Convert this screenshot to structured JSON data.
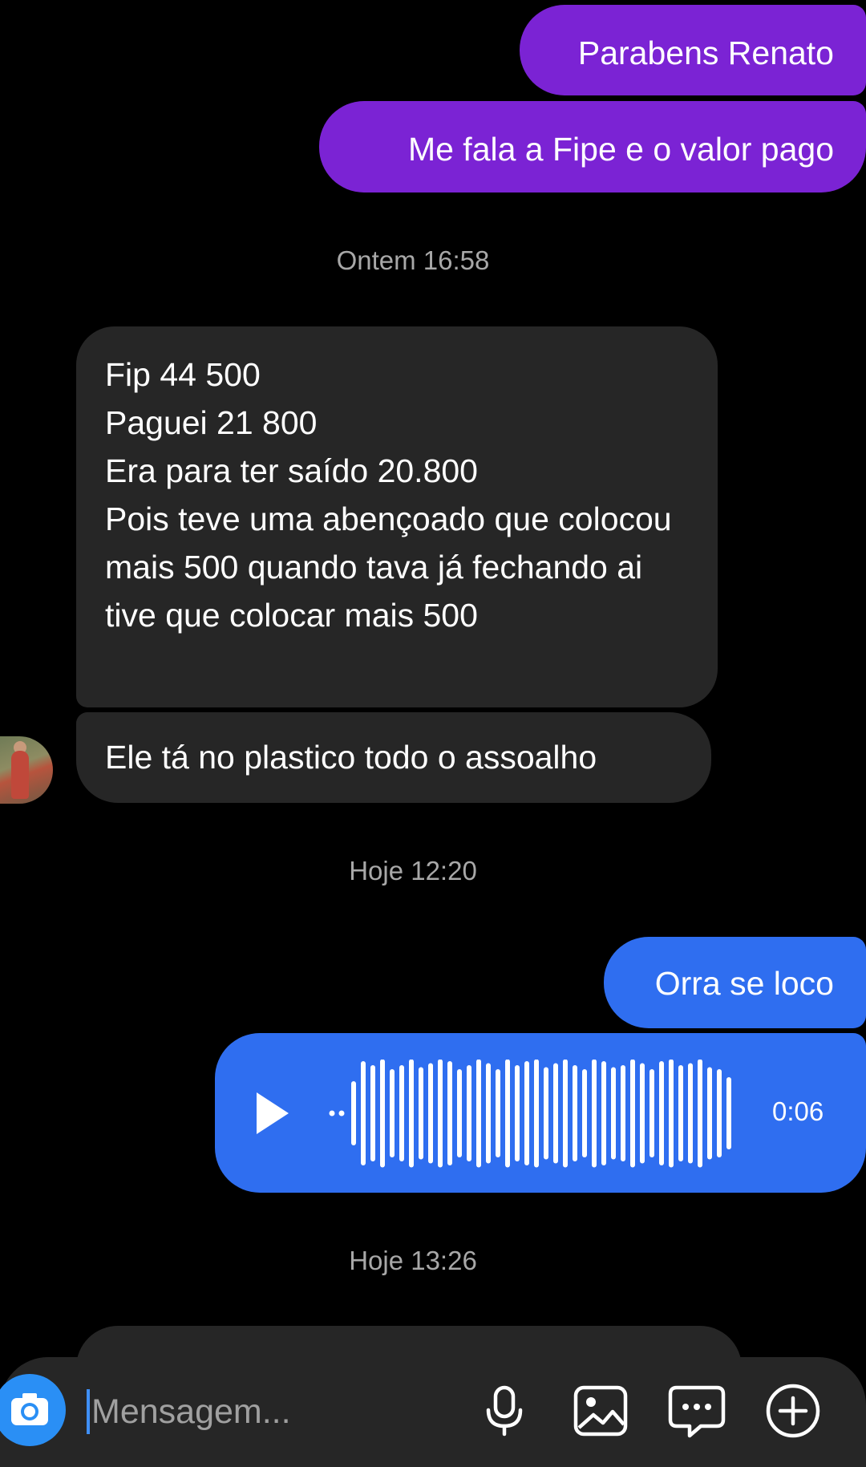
{
  "messages": {
    "out1": "Parabens Renato",
    "out2": "Me fala a Fipe e o valor pago",
    "ts1": "Ontem 16:58",
    "in1": "Fip 44 500\nPaguei 21 800\nEra para ter saído 20.800\nPois teve uma abençoado que colocou mais 500 quando tava já fechando ai tive que colocar mais 500",
    "in2": "Ele tá no plastico todo o assoalho",
    "ts2": "Hoje 12:20",
    "out3": "Orra se loco",
    "voice_duration": "0:06",
    "ts3": "Hoje 13:26"
  },
  "composer": {
    "placeholder": "Mensagem..."
  },
  "icons": {
    "camera": "camera-icon",
    "mic": "microphone-icon",
    "gallery": "image-icon",
    "sticker": "chat-bubble-icon",
    "plus": "plus-circle-icon"
  },
  "colors": {
    "outgoing": "#7b23d4",
    "outgoing_blue": "#2f6ef0",
    "incoming": "#262626",
    "accent": "#2a8ff5"
  }
}
